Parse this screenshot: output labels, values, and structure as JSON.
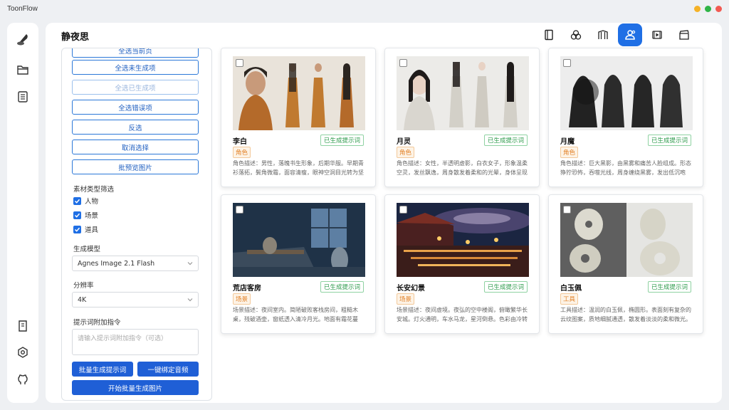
{
  "app": {
    "title": "ToonFlow"
  },
  "window_controls": [
    {
      "name": "minimize",
      "color": "#f5b227"
    },
    {
      "name": "maximize",
      "color": "#2fb446"
    },
    {
      "name": "close",
      "color": "#f25a52"
    }
  ],
  "page": {
    "title": "静夜思"
  },
  "sidebar": {
    "top_icons": [
      "quill-logo-icon",
      "folder-icon",
      "document-list-icon"
    ],
    "bottom_icons": [
      "book-icon",
      "settings-gear-icon",
      "github-icon"
    ]
  },
  "topnav": {
    "items": [
      {
        "icon": "script-book-icon",
        "active": false
      },
      {
        "icon": "three-circles-icon",
        "active": false
      },
      {
        "icon": "storyboard-grid-icon",
        "active": false
      },
      {
        "icon": "characters-icon",
        "active": true
      },
      {
        "icon": "video-play-icon",
        "active": false
      },
      {
        "icon": "clapperboard-icon",
        "active": false
      }
    ],
    "accent": "#1f6fe5"
  },
  "panel": {
    "select_buttons": [
      "全选当前页",
      "全选未生成项",
      "全选已生成项",
      "全选错误项",
      "反选",
      "取消选择",
      "批预览图片"
    ],
    "filter_label": "素材类型筛选",
    "filters": [
      {
        "label": "人物",
        "checked": true
      },
      {
        "label": "场景",
        "checked": true
      },
      {
        "label": "道具",
        "checked": true
      }
    ],
    "model_label": "生成模型",
    "model_value": "Agnes Image 2.1 Flash",
    "resolution_label": "分辨率",
    "resolution_value": "4K",
    "prompt_label": "提示词附加指令",
    "prompt_placeholder": "请输入提示词附加指令（可选）",
    "batch_prompt_button": "批量生成提示词",
    "bind_audio_button": "一键绑定音频",
    "batch_image_button": "开始批量生成图片"
  },
  "cards": [
    {
      "name": "李白",
      "status": "已生成提示词",
      "tag": "角色",
      "desc": "角色描述：男性，落魄书生形象，后期华服。早期青衫落拓，鬓角微霜，面容清瘦，眼神空洞目光转为坚毅。",
      "image": "libai"
    },
    {
      "name": "月灵",
      "status": "已生成提示词",
      "tag": "角色",
      "desc": "角色描述：女性，半透明虚影，白衣女子，形象温柔空灵，发丝飘逸，周身散发着柔和的光晕，身体呈现朦胧。",
      "image": "yueling"
    },
    {
      "name": "月魔",
      "status": "已生成提示词",
      "tag": "角色",
      "desc": "角色描述：巨大黑影，由黑雾和痛苦人脸组成。形态狰狞恐怖，吞噬光线，周身缠绕黑雾，发出低沉咆哮。",
      "image": "yuemo"
    },
    {
      "name": "荒店客房",
      "status": "已生成提示词",
      "tag": "场景",
      "desc": "场景描述：夜间室内。简陋破败客栈房间，粗糙木桌，残破酒壶，窗纸透入清冷月光。地面有霜花蔓延。",
      "image": "room"
    },
    {
      "name": "长安幻景",
      "status": "已生成提示词",
      "tag": "场景",
      "desc": "场景描述：夜间虚境。夜弘的空中楼阁，俯瞰繁华长安城。灯火通明，车水马龙，星河倒悬。色彩由冷转暖。",
      "image": "changan"
    },
    {
      "name": "白玉佩",
      "status": "已生成提示词",
      "tag": "工具",
      "desc": "工具描述：温润的白玉佩，椭圆形。表面刻有复杂的云纹图案，质地细腻通透，散发着淡淡的柔和微光。",
      "image": "jade"
    }
  ]
}
